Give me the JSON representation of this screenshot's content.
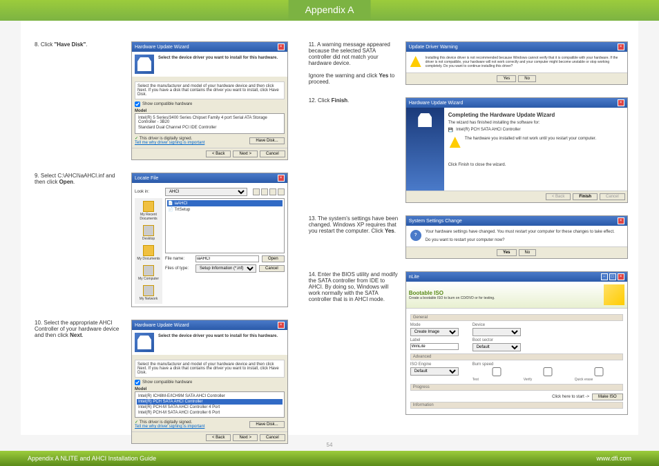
{
  "header": {
    "tab": "Appendix A"
  },
  "left": {
    "s8": {
      "num": "8.",
      "text": "Click ",
      "bold": "\"Have Disk\"",
      "after": "."
    },
    "s9": {
      "num": "9.",
      "text": "Select C:\\AHCI\\iaAHCI.inf and then click ",
      "bold": "Open",
      "after": "."
    },
    "s10": {
      "num": "10.",
      "text": "Select the appropriate AHCI Controller of your hardware device and then click ",
      "bold": "Next",
      "after": "."
    },
    "wiz8": {
      "title": "Hardware Update Wizard",
      "head": "Select the device driver you want to install for this hardware.",
      "instr": "Select the manufacturer and model of your hardware device and then click Next. If you have a disk that contains the driver you want to install, click Have Disk.",
      "chk": "Show compatible hardware",
      "model": "Model",
      "m1": "Intel(R) 5 Series/3400 Series Chipset Family 4 port Serial ATA Storage Controller - 3B20",
      "m2": "Standard Dual Channel PCI IDE Controller",
      "signed": "This driver is digitally signed.",
      "tell": "Tell me why driver signing is important",
      "have": "Have Disk...",
      "back": "< Back",
      "next": "Next >",
      "cancel": "Cancel"
    },
    "loc": {
      "title": "Locate File",
      "lookin": "Look in:",
      "folder": "AHCI",
      "f1": "iaAHCI",
      "f2": "TrtSetup",
      "fname": "File name:",
      "fval": "iaAHCI",
      "ftype": "Files of type:",
      "ftval": "Setup Information (*.inf)",
      "open": "Open",
      "cancel": "Cancel",
      "p1": "My Recent Documents",
      "p2": "Desktop",
      "p3": "My Documents",
      "p4": "My Computer",
      "p5": "My Network"
    },
    "wiz10": {
      "title": "Hardware Update Wizard",
      "head": "Select the device driver you want to install for this hardware.",
      "instr": "Select the manufacturer and model of your hardware device and then click Next. If you have a disk that contains the driver you want to install, click Have Disk.",
      "chk": "Show compatible hardware",
      "model": "Model",
      "m1": "Intel(R) ICH8M-E/ICH9M SATA AHCI Controller",
      "m2": "Intel(R) PCH SATA AHCI Controller",
      "m3": "Intel(R) PCH-M SATA AHCI Controller 4 Port",
      "m4": "Intel(R) PCH-M SATA AHCI Controller 6 Port",
      "signed": "This driver is digitally signed.",
      "tell": "Tell me why driver signing is important",
      "have": "Have Disk...",
      "back": "< Back",
      "next": "Next >",
      "cancel": "Cancel"
    }
  },
  "right": {
    "s11": {
      "num": "11.",
      "p1": "A warning message appeared because the selected SATA controller did not match your hardware device.",
      "p2": "Ignore the warning and click ",
      "bold": "Yes",
      "after": " to proceed."
    },
    "s12": {
      "num": "12.",
      "text": "Click ",
      "bold": "Finish",
      "after": "."
    },
    "s13": {
      "num": "13.",
      "text": "The system's settings have been changed. Windows XP requires that you restart the computer. Click ",
      "bold": "Yes",
      "after": "."
    },
    "s14": {
      "num": "14.",
      "text": "Enter the BIOS utility and modify the SATA controller from IDE to AHCI. By doing so, Windows will work normally with the SATA controller that is in AHCI mode."
    },
    "warn": {
      "title": "Update Driver Warning",
      "msg": "Installing this device driver is not recommended because Windows cannot verify that it is compatible with your hardware. If the driver is not compatible, your hardware will not work correctly and your computer might become unstable or stop working completely. Do you want to continue installing this driver?",
      "yes": "Yes",
      "no": "No"
    },
    "fin": {
      "title": "Hardware Update Wizard",
      "head": "Completing the Hardware Update Wizard",
      "p1": "The wizard has finished installing the software for:",
      "dev": "Intel(R) PCH SATA AHCI Controller",
      "p2": "The hardware you installed will not work until you restart your computer.",
      "p3": "Click Finish to close the wizard.",
      "back": "< Back",
      "finish": "Finish",
      "cancel": "Cancel"
    },
    "sys": {
      "title": "System Settings Change",
      "msg": "Your hardware settings have changed. You must restart your computer for these changes to take effect.",
      "q": "Do you want to restart your computer now?",
      "yes": "Yes",
      "no": "No"
    },
    "nlite": {
      "title": "nLite",
      "h1": "Bootable ISO",
      "h2": "Create a bootable ISO to burn on CD/DVD or for testing.",
      "general": "General",
      "mode": "Mode",
      "mval": "Create Image",
      "device": "Device",
      "label": "Label",
      "lval": "WinLite",
      "bootsec": "Boot sector",
      "bval": "Default",
      "adv": "Advanced",
      "iso": "ISO Engine",
      "ival": "Default",
      "burn": "Burn speed",
      "test": "Test",
      "verify": "Verify",
      "quick": "Quick erase",
      "prog": "Progress",
      "info": "Information",
      "click": "Click here to start ->",
      "make": "Make ISO"
    }
  },
  "footer": {
    "page": "54",
    "left": "Appendix A NLITE and AHCI Installation Guide",
    "right": "www.dfi.com"
  }
}
